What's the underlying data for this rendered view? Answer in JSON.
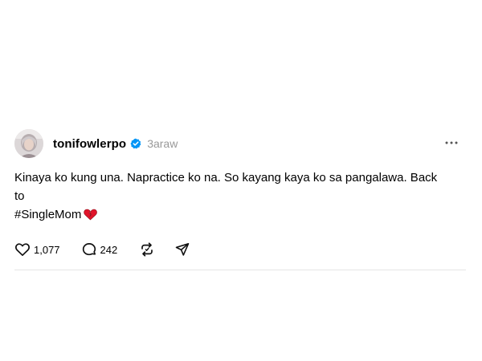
{
  "post": {
    "username": "tonifowlerpo",
    "timestamp": "3araw",
    "text_line1": "Kinaya ko kung una. Napractice ko na. So kayang kaya ko sa pangalawa. Back to",
    "text_line2": "#SingleMom",
    "likes": "1,077",
    "replies": "242"
  },
  "icons": {
    "verified": "verified-badge-icon",
    "more": "more-options-icon",
    "like": "heart-icon",
    "reply": "comment-icon",
    "repost": "repost-icon",
    "share": "send-icon",
    "emoji": "broken-heart-emoji"
  },
  "colors": {
    "verified": "#0095f6",
    "timestamp": "#999999",
    "divider": "#e6e6e6",
    "emoji": "#e0142a"
  }
}
